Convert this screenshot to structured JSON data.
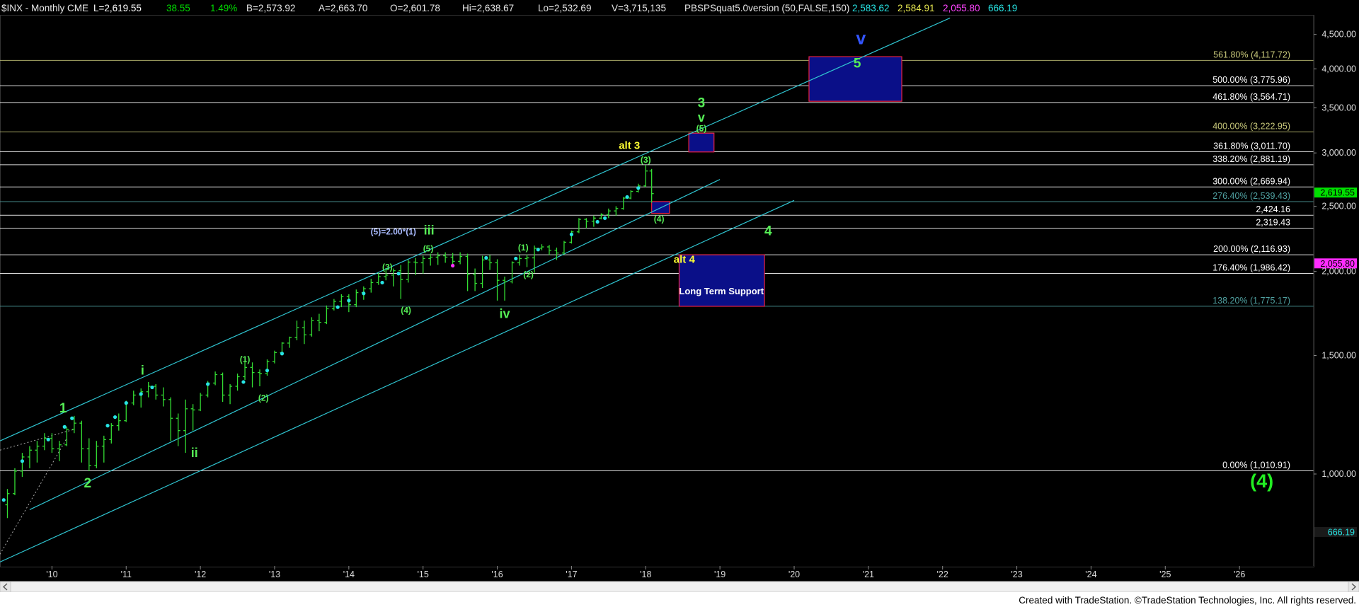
{
  "header": {
    "symbol": "$INX - Monthly  CME",
    "last": "L=2,619.55",
    "change": "38.55",
    "pct": "1.49%",
    "bid": "B=2,573.92",
    "ask": "A=2,663.70",
    "open": "O=2,601.78",
    "high": "Hi=2,638.67",
    "low": "Lo=2,532.69",
    "volume": "V=3,715,135",
    "indicator": "PBSPSquat5.0version (50,FALSE,150)",
    "ind_v1": "2,583.62",
    "ind_v2": "2,584.91",
    "ind_v3": "2,055.80",
    "ind_v4": "666.19",
    "colors": {
      "symbol": "#e6e6e6",
      "last": "#ffffff",
      "pos": "#00dd00",
      "bam": "#e6e6e6",
      "v1": "#27e4e4",
      "v2": "#e6e650",
      "v3": "#ff44ff",
      "v4": "#27e4e4"
    }
  },
  "footer": {
    "credit": "Created with TradeStation. ©TradeStation Technologies, Inc. All rights reserved."
  },
  "chart_data": {
    "type": "bar",
    "subtype": "ohlc-monthly",
    "scale": "log",
    "ylim": [
      730,
      4800
    ],
    "xlim": [
      2009.3,
      2027.0
    ],
    "yticks": [
      1000,
      1500,
      2000,
      2500,
      3000,
      3500,
      4000,
      4500
    ],
    "ytick_labels": [
      "1,000.00",
      "1,500.00",
      "2,000.00",
      "2,500.00",
      "3,000.00",
      "3,500.00",
      "4,000.00",
      "4,500.00"
    ],
    "xticks": [
      2010,
      2011,
      2012,
      2013,
      2014,
      2015,
      2016,
      2017,
      2018,
      2019,
      2020,
      2021,
      2022,
      2023,
      2024,
      2025,
      2026
    ],
    "xtick_labels": [
      "'10",
      "'11",
      "'12",
      "'13",
      "'14",
      "'15",
      "'16",
      "'17",
      "'18",
      "'19",
      "'20",
      "'21",
      "'22",
      "'23",
      "'24",
      "'25",
      "'26"
    ],
    "price_tags": [
      {
        "value": 2619.55,
        "text": "2,619.55",
        "bg": "#00e000",
        "fg": "#000000"
      },
      {
        "value": 2055.8,
        "text": "2,055.80",
        "bg": "#ff2bff",
        "fg": "#000000"
      },
      {
        "value": 820,
        "text": "666.19",
        "bg": "#1a1a1a",
        "fg": "#27e4e4"
      }
    ],
    "fib_levels": [
      {
        "value": 4117.72,
        "text": "561.80% (4,117.72)",
        "color": "#c8c87a"
      },
      {
        "value": 3775.96,
        "text": "500.00% (3,775.96)",
        "color": "#ffffff"
      },
      {
        "value": 3564.71,
        "text": "461.80% (3,564.71)",
        "color": "#ffffff"
      },
      {
        "value": 3222.95,
        "text": "400.00% (3,222.95)",
        "color": "#c8c87a"
      },
      {
        "value": 3011.7,
        "text": "361.80% (3,011.70)",
        "color": "#ffffff"
      },
      {
        "value": 2881.19,
        "text": "338.20% (2,881.19)",
        "color": "#ffffff"
      },
      {
        "value": 2669.94,
        "text": "300.00% (2,669.94)",
        "color": "#ffffff"
      },
      {
        "value": 2539.43,
        "text": "276.40% (2,539.43)",
        "color": "#4fa0a0"
      },
      {
        "value": 2424.16,
        "text": "2,424.16",
        "color": "#ffffff"
      },
      {
        "value": 2319.43,
        "text": "2,319.43",
        "color": "#ffffff"
      },
      {
        "value": 2116.93,
        "text": "200.00% (2,116.93)",
        "color": "#ffffff"
      },
      {
        "value": 1986.42,
        "text": "176.40% (1,986.42)",
        "color": "#ffffff"
      },
      {
        "value": 1775.17,
        "text": "138.20% (1,775.17)",
        "color": "#4fa0a0"
      },
      {
        "value": 1010.91,
        "text": "0.00% (1,010.91)",
        "color": "#ffffff"
      }
    ],
    "channels": [
      {
        "x1": 2009.3,
        "y1": 1120,
        "x2": 2022.1,
        "y2": 4760
      },
      {
        "x1": 2009.7,
        "y1": 885,
        "x2": 2019.0,
        "y2": 2740
      },
      {
        "x1": 2009.3,
        "y1": 740,
        "x2": 2020.0,
        "y2": 2550
      }
    ],
    "dotted_lines": [
      {
        "x1": 2009.3,
        "y1": 1085,
        "x2": 2010.3,
        "y2": 1165
      },
      {
        "x1": 2009.3,
        "y1": 760,
        "x2": 2010.2,
        "y2": 1130
      }
    ],
    "boxes": [
      {
        "x1": 2020.2,
        "y1": 3580,
        "x2": 2021.45,
        "y2": 4170
      },
      {
        "x1": 2018.58,
        "y1": 3010,
        "x2": 2018.92,
        "y2": 3210
      },
      {
        "x1": 2018.08,
        "y1": 2440,
        "x2": 2018.32,
        "y2": 2540
      },
      {
        "x1": 2018.45,
        "y1": 1775,
        "x2": 2019.6,
        "y2": 2117
      }
    ],
    "box_texts": [
      {
        "x": 2019.02,
        "y": 1850,
        "text": "Long Term Support",
        "color": "#ffffff"
      }
    ],
    "wave_labels": [
      {
        "x": 2020.9,
        "y": 4350,
        "text": "v",
        "color": "#3355ff",
        "size": 25
      },
      {
        "x": 2020.85,
        "y": 4020,
        "text": "5",
        "color": "#55ee55",
        "size": 19
      },
      {
        "x": 2018.75,
        "y": 3510,
        "text": "3",
        "color": "#55ee55",
        "size": 19
      },
      {
        "x": 2018.75,
        "y": 3340,
        "text": "v",
        "color": "#55ee55",
        "size": 18
      },
      {
        "x": 2018.75,
        "y": 3230,
        "text": "(5)",
        "color": "#55ee55",
        "size": 12
      },
      {
        "x": 2017.78,
        "y": 3040,
        "text": "alt 3",
        "color": "#ffff33",
        "size": 15
      },
      {
        "x": 2018.0,
        "y": 2900,
        "text": "(3)",
        "color": "#55ee55",
        "size": 12
      },
      {
        "x": 2018.18,
        "y": 2370,
        "text": "(4)",
        "color": "#55ee55",
        "size": 12
      },
      {
        "x": 2019.65,
        "y": 2265,
        "text": "4",
        "color": "#55ee55",
        "size": 19
      },
      {
        "x": 2018.52,
        "y": 2060,
        "text": "alt 4",
        "color": "#ffff33",
        "size": 15
      },
      {
        "x": 2014.6,
        "y": 2270,
        "text": "(5)=2.00*(1)",
        "color": "#aabbff",
        "size": 12
      },
      {
        "x": 2015.08,
        "y": 2270,
        "text": "iii",
        "color": "#55ee55",
        "size": 18
      },
      {
        "x": 2015.07,
        "y": 2140,
        "text": "(5)",
        "color": "#55ee55",
        "size": 12
      },
      {
        "x": 2014.52,
        "y": 2010,
        "text": "(3)",
        "color": "#55ee55",
        "size": 12
      },
      {
        "x": 2014.77,
        "y": 1735,
        "text": "(4)",
        "color": "#55ee55",
        "size": 12
      },
      {
        "x": 2016.1,
        "y": 1705,
        "text": "iv",
        "color": "#55ee55",
        "size": 18
      },
      {
        "x": 2016.35,
        "y": 2150,
        "text": "(1)",
        "color": "#55ee55",
        "size": 12
      },
      {
        "x": 2016.42,
        "y": 1960,
        "text": "(2)",
        "color": "#55ee55",
        "size": 12
      },
      {
        "x": 2012.6,
        "y": 1465,
        "text": "(1)",
        "color": "#55ee55",
        "size": 12
      },
      {
        "x": 2012.85,
        "y": 1285,
        "text": "(2)",
        "color": "#55ee55",
        "size": 12
      },
      {
        "x": 2011.22,
        "y": 1405,
        "text": "i",
        "color": "#55ee55",
        "size": 18
      },
      {
        "x": 2011.92,
        "y": 1060,
        "text": "ii",
        "color": "#55ee55",
        "size": 18
      },
      {
        "x": 2010.15,
        "y": 1235,
        "text": "1",
        "color": "#55ee55",
        "size": 19
      },
      {
        "x": 2010.48,
        "y": 955,
        "text": "2",
        "color": "#55ee55",
        "size": 19
      },
      {
        "x": 2026.3,
        "y": 955,
        "text": "(4)",
        "color": "#22ee22",
        "size": 27
      }
    ],
    "markers": [
      {
        "x": 2009.35,
        "y": 915,
        "color": "#27e4e4"
      },
      {
        "x": 2009.6,
        "y": 1045,
        "color": "#27e4e4"
      },
      {
        "x": 2009.95,
        "y": 1125,
        "color": "#27e4e4"
      },
      {
        "x": 2010.17,
        "y": 1175,
        "color": "#27e4e4"
      },
      {
        "x": 2010.27,
        "y": 1210,
        "color": "#27e4e4"
      },
      {
        "x": 2010.75,
        "y": 1180,
        "color": "#27e4e4"
      },
      {
        "x": 2010.85,
        "y": 1215,
        "color": "#27e4e4"
      },
      {
        "x": 2011.0,
        "y": 1275,
        "color": "#27e4e4"
      },
      {
        "x": 2011.2,
        "y": 1315,
        "color": "#27e4e4"
      },
      {
        "x": 2011.35,
        "y": 1345,
        "color": "#27e4e4"
      },
      {
        "x": 2012.1,
        "y": 1360,
        "color": "#27e4e4"
      },
      {
        "x": 2012.58,
        "y": 1370,
        "color": "#27e4e4"
      },
      {
        "x": 2012.9,
        "y": 1425,
        "color": "#27e4e4"
      },
      {
        "x": 2013.1,
        "y": 1510,
        "color": "#27e4e4"
      },
      {
        "x": 2013.85,
        "y": 1770,
        "color": "#27e4e4"
      },
      {
        "x": 2014.0,
        "y": 1810,
        "color": "#27e4e4"
      },
      {
        "x": 2014.2,
        "y": 1855,
        "color": "#27e4e4"
      },
      {
        "x": 2014.45,
        "y": 1925,
        "color": "#27e4e4"
      },
      {
        "x": 2014.67,
        "y": 1985,
        "color": "#27e4e4"
      },
      {
        "x": 2015.4,
        "y": 2040,
        "color": "#ff33ff"
      },
      {
        "x": 2015.85,
        "y": 2095,
        "color": "#27e4e4"
      },
      {
        "x": 2016.25,
        "y": 2090,
        "color": "#27e4e4"
      },
      {
        "x": 2016.55,
        "y": 2155,
        "color": "#27e4e4"
      },
      {
        "x": 2017.0,
        "y": 2270,
        "color": "#27e4e4"
      },
      {
        "x": 2017.35,
        "y": 2370,
        "color": "#27e4e4"
      },
      {
        "x": 2017.45,
        "y": 2400,
        "color": "#27e4e4"
      },
      {
        "x": 2017.75,
        "y": 2580,
        "color": "#27e4e4"
      },
      {
        "x": 2017.9,
        "y": 2660,
        "color": "#27e4e4"
      }
    ],
    "ohlc": [
      [
        2009.4,
        900,
        950,
        860,
        935
      ],
      [
        2009.5,
        935,
        1020,
        930,
        1010
      ],
      [
        2009.6,
        1010,
        1075,
        990,
        1060
      ],
      [
        2009.7,
        1060,
        1100,
        1020,
        1085
      ],
      [
        2009.8,
        1085,
        1120,
        1040,
        1100
      ],
      [
        2009.9,
        1100,
        1150,
        1085,
        1130
      ],
      [
        2010.0,
        1130,
        1150,
        1075,
        1090
      ],
      [
        2010.1,
        1090,
        1120,
        1045,
        1105
      ],
      [
        2010.2,
        1105,
        1175,
        1100,
        1165
      ],
      [
        2010.3,
        1165,
        1220,
        1150,
        1190
      ],
      [
        2010.4,
        1190,
        1200,
        1040,
        1090
      ],
      [
        2010.5,
        1090,
        1130,
        1010,
        1030
      ],
      [
        2010.6,
        1030,
        1120,
        1020,
        1100
      ],
      [
        2010.7,
        1100,
        1140,
        1040,
        1125
      ],
      [
        2010.8,
        1125,
        1190,
        1110,
        1180
      ],
      [
        2010.9,
        1180,
        1230,
        1160,
        1200
      ],
      [
        2011.0,
        1200,
        1285,
        1195,
        1275
      ],
      [
        2011.1,
        1275,
        1330,
        1265,
        1310
      ],
      [
        2011.2,
        1310,
        1340,
        1255,
        1325
      ],
      [
        2011.3,
        1325,
        1370,
        1300,
        1350
      ],
      [
        2011.4,
        1350,
        1360,
        1290,
        1310
      ],
      [
        2011.5,
        1310,
        1345,
        1260,
        1290
      ],
      [
        2011.6,
        1290,
        1300,
        1120,
        1210
      ],
      [
        2011.7,
        1210,
        1230,
        1100,
        1160
      ],
      [
        2011.8,
        1160,
        1290,
        1075,
        1250
      ],
      [
        2011.9,
        1250,
        1270,
        1160,
        1245
      ],
      [
        2012.0,
        1245,
        1320,
        1240,
        1310
      ],
      [
        2012.1,
        1310,
        1375,
        1300,
        1365
      ],
      [
        2012.2,
        1365,
        1420,
        1355,
        1405
      ],
      [
        2012.3,
        1405,
        1415,
        1280,
        1310
      ],
      [
        2012.4,
        1310,
        1360,
        1270,
        1350
      ],
      [
        2012.5,
        1350,
        1410,
        1330,
        1395
      ],
      [
        2012.6,
        1395,
        1470,
        1380,
        1440
      ],
      [
        2012.7,
        1440,
        1465,
        1345,
        1415
      ],
      [
        2012.8,
        1415,
        1430,
        1350,
        1410
      ],
      [
        2012.9,
        1410,
        1480,
        1400,
        1470
      ],
      [
        2013.0,
        1470,
        1525,
        1460,
        1515
      ],
      [
        2013.1,
        1515,
        1570,
        1500,
        1565
      ],
      [
        2013.2,
        1565,
        1600,
        1540,
        1595
      ],
      [
        2013.3,
        1595,
        1690,
        1580,
        1650
      ],
      [
        2013.4,
        1650,
        1690,
        1560,
        1610
      ],
      [
        2013.5,
        1610,
        1710,
        1600,
        1690
      ],
      [
        2013.6,
        1690,
        1730,
        1630,
        1680
      ],
      [
        2013.7,
        1680,
        1780,
        1670,
        1760
      ],
      [
        2013.8,
        1760,
        1820,
        1750,
        1805
      ],
      [
        2013.9,
        1805,
        1850,
        1770,
        1835
      ],
      [
        2014.0,
        1835,
        1850,
        1740,
        1785
      ],
      [
        2014.1,
        1785,
        1880,
        1770,
        1860
      ],
      [
        2014.2,
        1860,
        1900,
        1815,
        1885
      ],
      [
        2014.3,
        1885,
        1950,
        1860,
        1925
      ],
      [
        2014.4,
        1925,
        1990,
        1910,
        1965
      ],
      [
        2014.5,
        1965,
        2010,
        1940,
        1975
      ],
      [
        2014.6,
        1975,
        2020,
        1900,
        2005
      ],
      [
        2014.7,
        2005,
        2045,
        1820,
        1945
      ],
      [
        2014.8,
        1945,
        2080,
        1925,
        2065
      ],
      [
        2014.9,
        2065,
        2095,
        1975,
        2060
      ],
      [
        2015.0,
        2060,
        2110,
        1985,
        2090
      ],
      [
        2015.1,
        2090,
        2125,
        2040,
        2100
      ],
      [
        2015.2,
        2100,
        2135,
        2045,
        2110
      ],
      [
        2015.3,
        2110,
        2135,
        2060,
        2100
      ],
      [
        2015.4,
        2100,
        2130,
        2030,
        2070
      ],
      [
        2015.5,
        2070,
        2135,
        2050,
        2105
      ],
      [
        2015.6,
        2105,
        2125,
        1870,
        1980
      ],
      [
        2015.7,
        1980,
        2020,
        1870,
        1920
      ],
      [
        2015.8,
        1920,
        2110,
        1890,
        2080
      ],
      [
        2015.9,
        2080,
        2115,
        2010,
        2060
      ],
      [
        2016.0,
        2060,
        2085,
        1810,
        1940
      ],
      [
        2016.1,
        1940,
        1965,
        1810,
        1930
      ],
      [
        2016.2,
        1930,
        2070,
        1920,
        2060
      ],
      [
        2016.3,
        2060,
        2115,
        2040,
        2090
      ],
      [
        2016.4,
        2090,
        2120,
        2030,
        2095
      ],
      [
        2016.5,
        2095,
        2185,
        1990,
        2165
      ],
      [
        2016.6,
        2165,
        2195,
        2150,
        2175
      ],
      [
        2016.7,
        2175,
        2190,
        2115,
        2150
      ],
      [
        2016.8,
        2150,
        2170,
        2080,
        2130
      ],
      [
        2016.9,
        2130,
        2220,
        2120,
        2210
      ],
      [
        2017.0,
        2210,
        2300,
        2200,
        2290
      ],
      [
        2017.1,
        2290,
        2400,
        2280,
        2390
      ],
      [
        2017.2,
        2390,
        2400,
        2320,
        2375
      ],
      [
        2017.3,
        2375,
        2420,
        2330,
        2400
      ],
      [
        2017.4,
        2400,
        2440,
        2390,
        2430
      ],
      [
        2017.5,
        2430,
        2480,
        2400,
        2460
      ],
      [
        2017.6,
        2460,
        2500,
        2420,
        2480
      ],
      [
        2017.7,
        2480,
        2580,
        2470,
        2570
      ],
      [
        2017.8,
        2570,
        2640,
        2560,
        2630
      ],
      [
        2017.9,
        2630,
        2700,
        2620,
        2680
      ],
      [
        2018.0,
        2680,
        2880,
        2670,
        2820
      ],
      [
        2018.08,
        2820,
        2840,
        2530,
        2610
      ]
    ]
  }
}
